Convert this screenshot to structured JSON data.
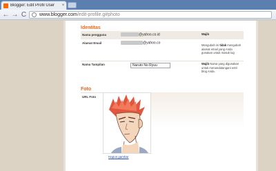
{
  "browser": {
    "tab_title": "Blogger: Edit Profil User",
    "tab_close": "×",
    "url_domain": "www.blogger.com",
    "url_path": "/edit-profile.g#photo",
    "back": "←",
    "forward": "→",
    "reload": "C"
  },
  "identitas": {
    "title": "Identitas",
    "username_label": "Nama pengguna",
    "username_suffix": "@yahoo.co.id",
    "username_hint": "Wajib",
    "email_label": "Alamat Email",
    "email_suffix": "@yahoo.co",
    "email_hint_pre": "Mengubah ini ",
    "email_hint_bold": "tidak",
    "email_hint_post": " mengubah alamat email yang Anda gunakan untuk masuk log",
    "display_label": "Nama Tampilan",
    "display_value": "Naruto No Ryuu",
    "display_hint_bold": "Wajib",
    "display_hint": " Nama yang digunakan untuk menandatangani entri blog Anda."
  },
  "foto": {
    "title": "Foto",
    "url_label": "URL Foto",
    "remove_link": "Hapus gambar"
  }
}
